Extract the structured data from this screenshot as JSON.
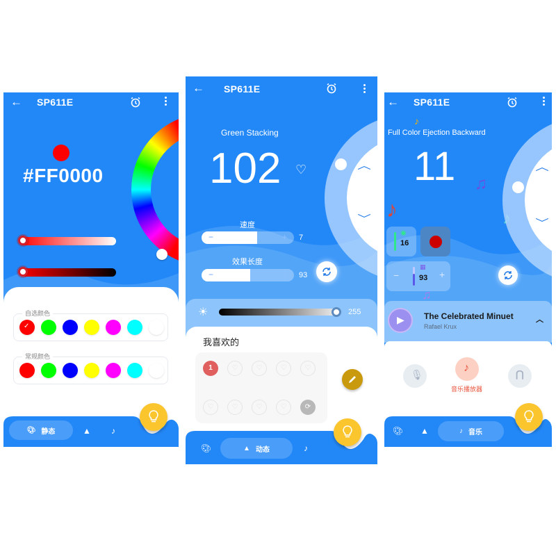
{
  "colors": {
    "brand_blue": "#2388f7",
    "fab_yellow": "#fbc52d",
    "edit_gold": "#c99a0e",
    "music_red": "#e8553d",
    "favorite_red": "#e06060"
  },
  "common": {
    "device_name": "SP611E",
    "back_icon": "arrow-left-icon",
    "alarm_icon": "alarm-clock-icon",
    "more_icon": "more-vertical-icon",
    "fab_icon": "lightbulb-icon"
  },
  "static_screen": {
    "hex_color": "#FF0000",
    "current_color": "#ff0000",
    "saturation_slider": 0.0,
    "brightness_slider": 0.0,
    "custom_colors_label": "自选颜色",
    "custom_colors": [
      "#ff0000",
      "#00ff00",
      "#0000ff",
      "#ffff00",
      "#ff00ff",
      "#00ffff",
      "#ffffff"
    ],
    "custom_selected_index": 0,
    "regular_colors_label": "常规颜色",
    "regular_colors": [
      "#ff0000",
      "#00ff00",
      "#0000ff",
      "#ffff00",
      "#ff00ff",
      "#00ffff",
      "#ffffff"
    ],
    "tabs": [
      {
        "label": "静态",
        "icon": "palette-icon",
        "active": true
      },
      {
        "label": "",
        "icon": "shapes-icon",
        "active": false
      },
      {
        "label": "",
        "icon": "music-note-icon",
        "active": false
      }
    ]
  },
  "dynamic_screen": {
    "effect_name": "Green Stacking",
    "effect_number": "102",
    "speed_label": "速度",
    "speed_value": "7",
    "speed_fraction": 0.6,
    "length_label": "效果长度",
    "length_value": "93",
    "length_fraction": 0.53,
    "brightness_value": "255",
    "brightness_fraction": 1.0,
    "favorites_title": "我喜欢的",
    "favorites_first_badge": "1",
    "favorites_slots": 10,
    "tabs": [
      {
        "label": "",
        "icon": "palette-icon",
        "active": false
      },
      {
        "label": "动态",
        "icon": "shapes-icon",
        "active": true
      },
      {
        "label": "",
        "icon": "music-note-icon",
        "active": false
      }
    ]
  },
  "music_screen": {
    "effect_name": "Full Color Ejection Backward",
    "effect_number": "11",
    "sensitivity_value": "16",
    "length_value": "93",
    "track_title": "The Celebrated Minuet",
    "track_artist": "Rafael Krux",
    "mode_label": "音乐播放器",
    "modes": [
      {
        "icon": "microphone-icon",
        "active": false
      },
      {
        "icon": "music-note-icon",
        "active": true
      },
      {
        "icon": "earphones-icon",
        "active": false
      }
    ],
    "tabs": [
      {
        "label": "",
        "icon": "palette-icon",
        "active": false
      },
      {
        "label": "",
        "icon": "shapes-icon",
        "active": false
      },
      {
        "label": "音乐",
        "icon": "music-note-icon",
        "active": true
      }
    ]
  }
}
